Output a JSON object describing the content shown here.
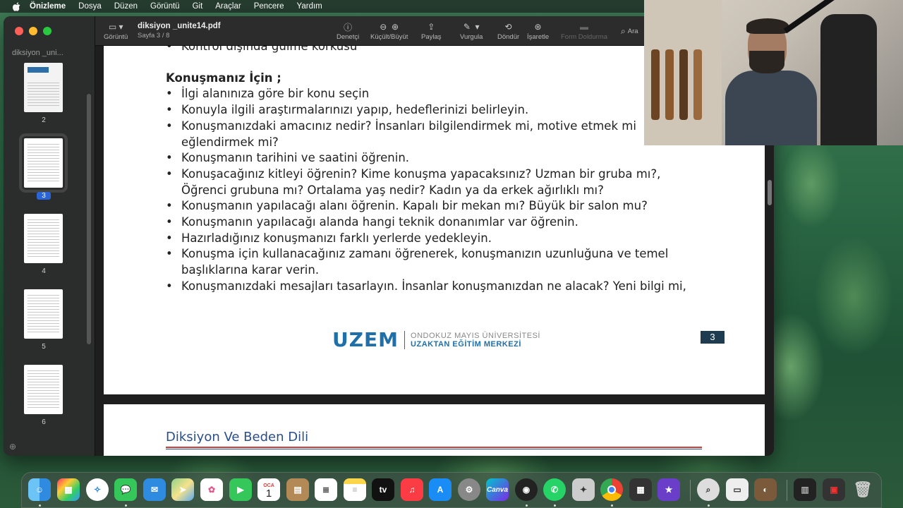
{
  "menubar": {
    "app_name": "Önizleme",
    "items": [
      "Dosya",
      "Düzen",
      "Görüntü",
      "Git",
      "Araçlar",
      "Pencere",
      "Yardım"
    ]
  },
  "window": {
    "doc_title": "diksiyon _unite14.pdf",
    "doc_subtitle": "Sayfa 3 / 8",
    "sidebar_title": "diksiyon _uni...",
    "view_label": "Görüntü",
    "toolbar": {
      "inspector": "Denetçi",
      "zoom": "Küçült/Büyüt",
      "share": "Paylaş",
      "highlight": "Vurgula",
      "rotate": "Döndür",
      "markup": "İşaretle",
      "form_fill": "Form Doldurma",
      "search_placeholder": "Ara"
    },
    "thumbnails": [
      {
        "page": "2",
        "active": false
      },
      {
        "page": "3",
        "active": true
      },
      {
        "page": "4",
        "active": false
      },
      {
        "page": "5",
        "active": false
      },
      {
        "page": "6",
        "active": false
      }
    ]
  },
  "document": {
    "partial_top_line": "Kontrol dışında gülme korkusu",
    "heading": "Konuşmanız İçin ;",
    "bullets": [
      "İlgi alanınıza göre bir konu seçin",
      "Konuyla ilgili araştırmalarınızı yapıp, hedeflerinizi belirleyin.",
      "Konuşmanızdaki amacınız nedir? İnsanları bilgilendirmek mi, motive etmek mi eğlendirmek mi?",
      "Konuşmanın tarihini ve saatini öğrenin.",
      "Konuşacağınız kitleyi öğrenin? Kime konuşma yapacaksınız? Uzman bir gruba mı?, Öğrenci grubuna mı? Ortalama yaş nedir? Kadın ya da erkek ağırlıklı mı?",
      "Konuşmanın yapılacağı alanı öğrenin. Kapalı bir mekan mı? Büyük bir salon mu?",
      "Konuşmanın yapılacağı alanda hangi teknik donanımlar var öğrenin.",
      "Hazırladığınız konuşmanızı farklı yerlerde yedekleyin.",
      "Konuşma için kullanacağınız zamanı öğrenerek, konuşmanızın uzunluğuna ve temel başlıklarına karar verin.",
      "Konuşmanızdaki mesajları tasarlayın. İnsanlar konuşmanızdan ne alacak? Yeni bilgi mi,"
    ],
    "logo": {
      "mark": "UZEM",
      "line1": "ONDOKUZ MAYIS ÜNİVERSİTESİ",
      "line2": "UZAKTAN EĞİTİM MERKEZİ"
    },
    "page_number": "3",
    "next_page_title": "Diksiyon Ve Beden Dili"
  },
  "dock": {
    "calendar_month": "OCA",
    "calendar_day": "1",
    "apps": [
      "Finder",
      "Launchpad",
      "Safari",
      "Messages",
      "Mail",
      "Maps",
      "Photos",
      "FaceTime",
      "Calendar",
      "Notes Folder",
      "Reminders",
      "Notes",
      "TV",
      "Music",
      "App Store",
      "System Settings",
      "Canva",
      "Screen Recorder",
      "WhatsApp",
      "Utility",
      "Chrome",
      "Calculator",
      "iMovie",
      "Preview",
      "Screenshot",
      "Photo",
      "Audio",
      "Video",
      "Trash"
    ],
    "tv_label": "tv",
    "canva_label": "Canva"
  }
}
